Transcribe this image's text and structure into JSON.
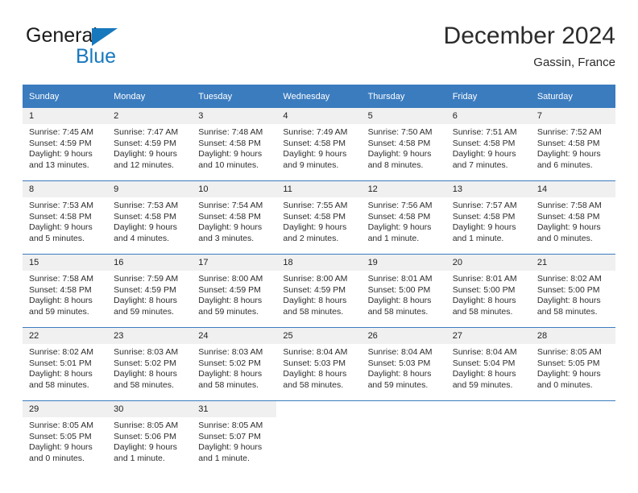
{
  "brand": {
    "name_part1": "General",
    "name_part2": "Blue",
    "triangle_color": "#1878be"
  },
  "header": {
    "title": "December 2024",
    "subtitle": "Gassin, France"
  },
  "theme": {
    "header_bg": "#3b7cbf",
    "header_text": "#ffffff",
    "daynum_bg": "#f0f0f0",
    "row_divider": "#3b7cbf",
    "body_text": "#2d2d2d"
  },
  "weekdays": [
    "Sunday",
    "Monday",
    "Tuesday",
    "Wednesday",
    "Thursday",
    "Friday",
    "Saturday"
  ],
  "weeks": [
    [
      {
        "day": "1",
        "sunrise": "Sunrise: 7:45 AM",
        "sunset": "Sunset: 4:59 PM",
        "daylight1": "Daylight: 9 hours",
        "daylight2": "and 13 minutes."
      },
      {
        "day": "2",
        "sunrise": "Sunrise: 7:47 AM",
        "sunset": "Sunset: 4:59 PM",
        "daylight1": "Daylight: 9 hours",
        "daylight2": "and 12 minutes."
      },
      {
        "day": "3",
        "sunrise": "Sunrise: 7:48 AM",
        "sunset": "Sunset: 4:58 PM",
        "daylight1": "Daylight: 9 hours",
        "daylight2": "and 10 minutes."
      },
      {
        "day": "4",
        "sunrise": "Sunrise: 7:49 AM",
        "sunset": "Sunset: 4:58 PM",
        "daylight1": "Daylight: 9 hours",
        "daylight2": "and 9 minutes."
      },
      {
        "day": "5",
        "sunrise": "Sunrise: 7:50 AM",
        "sunset": "Sunset: 4:58 PM",
        "daylight1": "Daylight: 9 hours",
        "daylight2": "and 8 minutes."
      },
      {
        "day": "6",
        "sunrise": "Sunrise: 7:51 AM",
        "sunset": "Sunset: 4:58 PM",
        "daylight1": "Daylight: 9 hours",
        "daylight2": "and 7 minutes."
      },
      {
        "day": "7",
        "sunrise": "Sunrise: 7:52 AM",
        "sunset": "Sunset: 4:58 PM",
        "daylight1": "Daylight: 9 hours",
        "daylight2": "and 6 minutes."
      }
    ],
    [
      {
        "day": "8",
        "sunrise": "Sunrise: 7:53 AM",
        "sunset": "Sunset: 4:58 PM",
        "daylight1": "Daylight: 9 hours",
        "daylight2": "and 5 minutes."
      },
      {
        "day": "9",
        "sunrise": "Sunrise: 7:53 AM",
        "sunset": "Sunset: 4:58 PM",
        "daylight1": "Daylight: 9 hours",
        "daylight2": "and 4 minutes."
      },
      {
        "day": "10",
        "sunrise": "Sunrise: 7:54 AM",
        "sunset": "Sunset: 4:58 PM",
        "daylight1": "Daylight: 9 hours",
        "daylight2": "and 3 minutes."
      },
      {
        "day": "11",
        "sunrise": "Sunrise: 7:55 AM",
        "sunset": "Sunset: 4:58 PM",
        "daylight1": "Daylight: 9 hours",
        "daylight2": "and 2 minutes."
      },
      {
        "day": "12",
        "sunrise": "Sunrise: 7:56 AM",
        "sunset": "Sunset: 4:58 PM",
        "daylight1": "Daylight: 9 hours",
        "daylight2": "and 1 minute."
      },
      {
        "day": "13",
        "sunrise": "Sunrise: 7:57 AM",
        "sunset": "Sunset: 4:58 PM",
        "daylight1": "Daylight: 9 hours",
        "daylight2": "and 1 minute."
      },
      {
        "day": "14",
        "sunrise": "Sunrise: 7:58 AM",
        "sunset": "Sunset: 4:58 PM",
        "daylight1": "Daylight: 9 hours",
        "daylight2": "and 0 minutes."
      }
    ],
    [
      {
        "day": "15",
        "sunrise": "Sunrise: 7:58 AM",
        "sunset": "Sunset: 4:58 PM",
        "daylight1": "Daylight: 8 hours",
        "daylight2": "and 59 minutes."
      },
      {
        "day": "16",
        "sunrise": "Sunrise: 7:59 AM",
        "sunset": "Sunset: 4:59 PM",
        "daylight1": "Daylight: 8 hours",
        "daylight2": "and 59 minutes."
      },
      {
        "day": "17",
        "sunrise": "Sunrise: 8:00 AM",
        "sunset": "Sunset: 4:59 PM",
        "daylight1": "Daylight: 8 hours",
        "daylight2": "and 59 minutes."
      },
      {
        "day": "18",
        "sunrise": "Sunrise: 8:00 AM",
        "sunset": "Sunset: 4:59 PM",
        "daylight1": "Daylight: 8 hours",
        "daylight2": "and 58 minutes."
      },
      {
        "day": "19",
        "sunrise": "Sunrise: 8:01 AM",
        "sunset": "Sunset: 5:00 PM",
        "daylight1": "Daylight: 8 hours",
        "daylight2": "and 58 minutes."
      },
      {
        "day": "20",
        "sunrise": "Sunrise: 8:01 AM",
        "sunset": "Sunset: 5:00 PM",
        "daylight1": "Daylight: 8 hours",
        "daylight2": "and 58 minutes."
      },
      {
        "day": "21",
        "sunrise": "Sunrise: 8:02 AM",
        "sunset": "Sunset: 5:00 PM",
        "daylight1": "Daylight: 8 hours",
        "daylight2": "and 58 minutes."
      }
    ],
    [
      {
        "day": "22",
        "sunrise": "Sunrise: 8:02 AM",
        "sunset": "Sunset: 5:01 PM",
        "daylight1": "Daylight: 8 hours",
        "daylight2": "and 58 minutes."
      },
      {
        "day": "23",
        "sunrise": "Sunrise: 8:03 AM",
        "sunset": "Sunset: 5:02 PM",
        "daylight1": "Daylight: 8 hours",
        "daylight2": "and 58 minutes."
      },
      {
        "day": "24",
        "sunrise": "Sunrise: 8:03 AM",
        "sunset": "Sunset: 5:02 PM",
        "daylight1": "Daylight: 8 hours",
        "daylight2": "and 58 minutes."
      },
      {
        "day": "25",
        "sunrise": "Sunrise: 8:04 AM",
        "sunset": "Sunset: 5:03 PM",
        "daylight1": "Daylight: 8 hours",
        "daylight2": "and 58 minutes."
      },
      {
        "day": "26",
        "sunrise": "Sunrise: 8:04 AM",
        "sunset": "Sunset: 5:03 PM",
        "daylight1": "Daylight: 8 hours",
        "daylight2": "and 59 minutes."
      },
      {
        "day": "27",
        "sunrise": "Sunrise: 8:04 AM",
        "sunset": "Sunset: 5:04 PM",
        "daylight1": "Daylight: 8 hours",
        "daylight2": "and 59 minutes."
      },
      {
        "day": "28",
        "sunrise": "Sunrise: 8:05 AM",
        "sunset": "Sunset: 5:05 PM",
        "daylight1": "Daylight: 9 hours",
        "daylight2": "and 0 minutes."
      }
    ],
    [
      {
        "day": "29",
        "sunrise": "Sunrise: 8:05 AM",
        "sunset": "Sunset: 5:05 PM",
        "daylight1": "Daylight: 9 hours",
        "daylight2": "and 0 minutes."
      },
      {
        "day": "30",
        "sunrise": "Sunrise: 8:05 AM",
        "sunset": "Sunset: 5:06 PM",
        "daylight1": "Daylight: 9 hours",
        "daylight2": "and 1 minute."
      },
      {
        "day": "31",
        "sunrise": "Sunrise: 8:05 AM",
        "sunset": "Sunset: 5:07 PM",
        "daylight1": "Daylight: 9 hours",
        "daylight2": "and 1 minute."
      },
      {
        "day": "",
        "sunrise": "",
        "sunset": "",
        "daylight1": "",
        "daylight2": ""
      },
      {
        "day": "",
        "sunrise": "",
        "sunset": "",
        "daylight1": "",
        "daylight2": ""
      },
      {
        "day": "",
        "sunrise": "",
        "sunset": "",
        "daylight1": "",
        "daylight2": ""
      },
      {
        "day": "",
        "sunrise": "",
        "sunset": "",
        "daylight1": "",
        "daylight2": ""
      }
    ]
  ]
}
